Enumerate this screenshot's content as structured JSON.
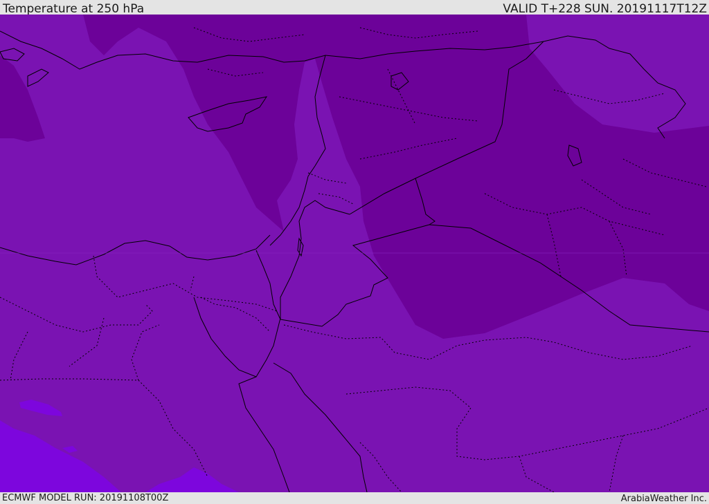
{
  "header": {
    "title": "Temperature at 250 hPa",
    "valid": "VALID T+228 SUN. 20191117T12Z"
  },
  "footer": {
    "model_run": "ECMWF MODEL RUN: 20191108T00Z",
    "credit": "ArabiaWeather Inc."
  },
  "map": {
    "field": "temperature",
    "level": "250 hPa",
    "colors": {
      "base_fill": "#7a13b2",
      "colder_fill": "#6c0299",
      "warmer_fill": "#7d06dd",
      "boundary_line": "#000000"
    }
  }
}
